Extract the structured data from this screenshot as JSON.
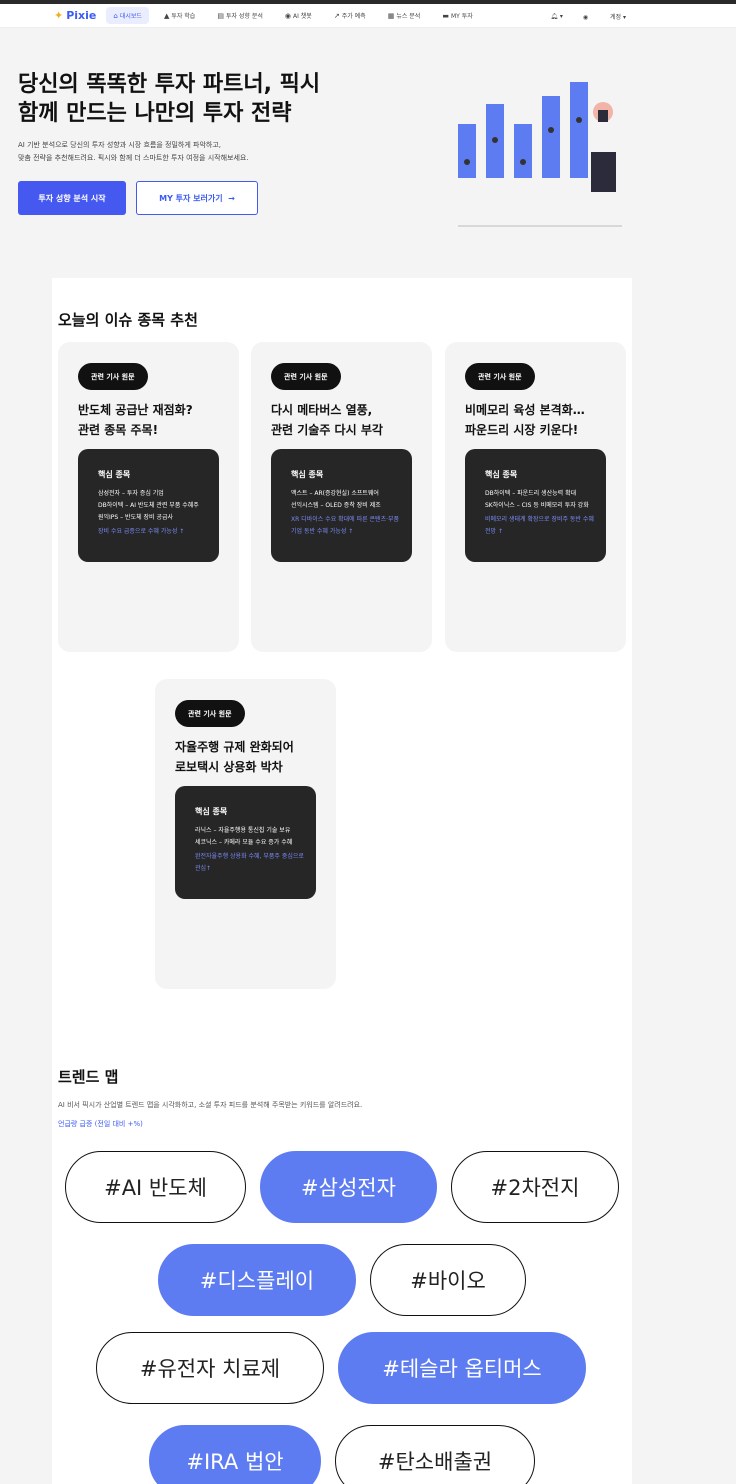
{
  "nav": {
    "brand": "Pixie",
    "items": [
      {
        "label": "대시보드",
        "icon": "home-icon"
      },
      {
        "label": "투자 학습",
        "icon": "graduation-cap-icon"
      },
      {
        "label": "투자 성향 분석",
        "icon": "clipboard-icon"
      },
      {
        "label": "AI 챗봇",
        "icon": "robot-icon"
      },
      {
        "label": "주가 예측",
        "icon": "line-chart-icon"
      },
      {
        "label": "뉴스 분석",
        "icon": "newspaper-icon"
      },
      {
        "label": "MY 투자",
        "icon": "wallet-icon"
      }
    ],
    "account_label": "계정"
  },
  "hero": {
    "title_line1": "당신의 똑똑한 투자 파트너, 픽시",
    "title_line2": "함께 만드는 나만의 투자 전략",
    "desc_line1": "AI 기반 분석으로 당신의 투자 성향과 시장 흐름을 정밀하게 파악하고,",
    "desc_line2": "맞춤 전략을 추천해드려요. 픽시와 함께 더 스마트한 투자 여정을 시작해보세요.",
    "primary_button": "투자 성향 분석 시작",
    "secondary_button": "MY 투자 보러가기",
    "arrow": "→"
  },
  "issues": {
    "title": "오늘의 이슈 종목 추천",
    "cards": [
      {
        "badge": "관련 기사 원문",
        "title_line1": "반도체 공급난 재점화?",
        "title_line2": "관련 종목 주목!",
        "box_title": "핵심 종목",
        "stocks": [
          "삼성전자 – 투자 증심 기업",
          "DB하이텍 – AI 반도체 관련 부품 수혜주",
          "원익IPS – 반도체 장비 공급사"
        ],
        "note": "장비 수요 급증으로 수혜 가능성 ↑"
      },
      {
        "badge": "관련 기사 원문",
        "title_line1": "다시 메타버스 열풍,",
        "title_line2": "관련 기술주 다시 부각",
        "box_title": "핵심 종목",
        "stocks": [
          "맥스트 – AR(증강현실) 소프트웨어",
          "선익시스템 – OLED 증착 장비 제조"
        ],
        "note": "XR 디바이스 수요 확대에 따른 콘텐츠·부품 기업 동반 수혜 가능성 ↑"
      },
      {
        "badge": "관련 기사 원문",
        "title_line1": "비메모리 육성 본격화…",
        "title_line2": "파운드리 시장 키운다!",
        "box_title": "핵심 종목",
        "stocks": [
          "DB하이텍 – 파운드리 생산능력 확대",
          "SK하이닉스 – CIS 등 비메모리 투자 강화"
        ],
        "note": "비메모리 생태계 확장으로 장비주 동반 수혜 전망 ↑"
      },
      {
        "badge": "관련 기사 원문",
        "title_line1": "자율주행 규제 완화되어",
        "title_line2": "로보택시 상용화 박차",
        "box_title": "핵심 종목",
        "stocks": [
          "라닉스 – 자율주행용 통신칩 기술 보유",
          "세코닉스 – 카메라 모듈 수요 증가 수혜"
        ],
        "note": "완전자율주행 상용화 수혜, 부품주 중심으로 관심↑"
      }
    ]
  },
  "trend": {
    "title": "트렌드 맵",
    "subtitle": "AI 비서 픽시가 산업별 트렌드 맵을 시각화하고, 소셜 투자 피드를 분석해 주목받는 키워드를 알려드려요.",
    "link": "언급량 급증 (전일 대비 +%)",
    "chips": [
      {
        "label": "#AI 반도체",
        "filled": false
      },
      {
        "label": "#삼성전자",
        "filled": true
      },
      {
        "label": "#2차전지",
        "filled": false
      },
      {
        "label": "#디스플레이",
        "filled": true
      },
      {
        "label": "#바이오",
        "filled": false
      },
      {
        "label": "#유전자 치료제",
        "filled": false
      },
      {
        "label": "#테슬라 옵티머스",
        "filled": true
      },
      {
        "label": "#IRA 법안",
        "filled": true
      },
      {
        "label": "#탄소배출권",
        "filled": false
      }
    ]
  },
  "colors": {
    "accent": "#4558f0",
    "chip_fill": "#5e7cf2",
    "dark_box": "#262626",
    "note_blue": "#7b8cf7"
  }
}
